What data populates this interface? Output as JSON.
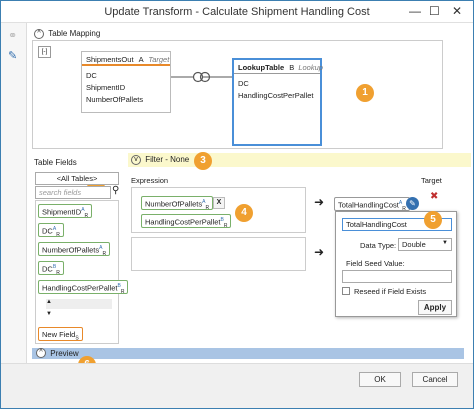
{
  "window": {
    "title": "Update Transform - Calculate Shipment Handling Cost",
    "minimize": "—",
    "maximize": "☐",
    "close": "✕"
  },
  "mapping": {
    "header": "Table Mapping",
    "toggle": "^",
    "collapse_btn": "[-]",
    "source_table": {
      "name": "ShipmentsOut",
      "alias": "A",
      "role": "Target",
      "fields": [
        "DC",
        "ShipmentID",
        "NumberOfPallets"
      ]
    },
    "lookup_table": {
      "name": "LookupTable",
      "alias": "B",
      "role": "Lookup",
      "fields": [
        "DC",
        "HandlingCostPerPallet"
      ]
    }
  },
  "fields": {
    "header": "Table Fields",
    "dropdown": "<All Tables>",
    "search_placeholder": "search fields",
    "items": [
      {
        "name": "ShipmentID",
        "sup": "A",
        "sub": "R"
      },
      {
        "name": "DC",
        "sup": "A",
        "sub": "R"
      },
      {
        "name": "NumberOfPallets",
        "sup": "A",
        "sub": "R"
      },
      {
        "name": "DC",
        "sup": "B",
        "sub": "R"
      },
      {
        "name": "HandlingCostPerPallet",
        "sup": "B",
        "sub": "R"
      }
    ],
    "up_arrow": "▲",
    "down_arrow": "▼",
    "new_field": "New Field",
    "new_field_sub": "S"
  },
  "filter": {
    "toggle": "v",
    "label": "Filter - None"
  },
  "expression": {
    "col_expression": "Expression",
    "col_target": "Target",
    "row1": {
      "chips": [
        {
          "name": "NumberOfPallets",
          "sup": "A",
          "sub": "R"
        },
        {
          "name": "HandlingCostPerPallet",
          "sup": "B",
          "sub": "R"
        }
      ],
      "x_label": "X",
      "arrow": "➜",
      "target": {
        "name": "TotalHandlingCost",
        "sup": "A",
        "sub": "R"
      },
      "delete": "✖"
    },
    "row2": {
      "arrow": "➜"
    }
  },
  "popup": {
    "name_value": "TotalHandlingCost",
    "datatype_label": "Data Type:",
    "datatype_value": "Double",
    "seed_label": "Field Seed Value:",
    "seed_value": "",
    "reseed_label": "Reseed if Field Exists",
    "apply": "Apply"
  },
  "preview": {
    "toggle": "^",
    "label": "Preview"
  },
  "footer": {
    "ok": "OK",
    "cancel": "Cancel"
  },
  "callouts": [
    "1",
    "2",
    "3",
    "4",
    "5",
    "6"
  ],
  "colors": {
    "accent_orange": "#f0a030",
    "chip_green": "#7ab06a",
    "filter_yellow": "#fbf8cc",
    "preview_blue": "#a9c4e4",
    "lookup_border": "#4a8fd8"
  }
}
